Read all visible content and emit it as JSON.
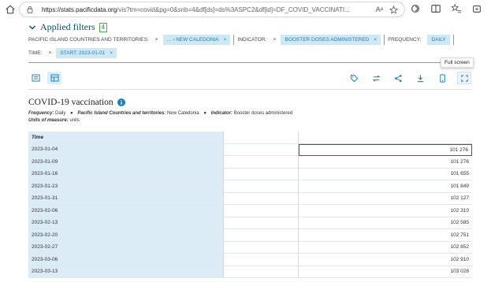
{
  "browser": {
    "url_host": "https://stats.pacificdata.org",
    "url_rest": "/vis?tm=covid&pg=0&snb=4&df[ds]=ds%3ASPC2&df[id]=DF_COVID_VACCINATI...",
    "reader_label": "Aᵃ"
  },
  "filters": {
    "title": "Applied filters",
    "count": "4",
    "row1": {
      "pict_label": "PACIFIC ISLAND COUNTRIES AND TERRITORIES:",
      "pict_chip": "... › NEW CALEDONIA",
      "indicator_label": "INDICATOR:",
      "indicator_chip": "BOOSTER DOSES ADMINISTERED",
      "frequency_label": "FREQUENCY:",
      "frequency_chip": "DAILY"
    },
    "row2": {
      "time_label": "TIME:",
      "time_chip": "START: 2023-01-01"
    },
    "remove_glyph": "×"
  },
  "tooltip": "Full screen",
  "header": {
    "title": "COVID-19 vaccination",
    "freq_key": "Frequency:",
    "freq_val": "Daily",
    "pict_key": "Pacific Island Countries and territories:",
    "pict_val": "New Caledonia",
    "ind_key": "Indicator:",
    "ind_val": "Booster doses administered",
    "units_key": "Units of measure:",
    "units_val": "units",
    "bullet": "●"
  },
  "table": {
    "header": "Time",
    "rows": [
      {
        "time": "2023-01-04",
        "value": "101 276"
      },
      {
        "time": "2023-01-09",
        "value": "101 276"
      },
      {
        "time": "2023-01-16",
        "value": "101 655"
      },
      {
        "time": "2023-01-23",
        "value": "101 849"
      },
      {
        "time": "2023-01-31",
        "value": "102 127"
      },
      {
        "time": "2023-02-06",
        "value": "102 310"
      },
      {
        "time": "2023-02-13",
        "value": "102 585"
      },
      {
        "time": "2023-02-20",
        "value": "102 751"
      },
      {
        "time": "2023-02-27",
        "value": "102 852"
      },
      {
        "time": "2023-03-06",
        "value": "102 910"
      },
      {
        "time": "2023-03-13",
        "value": "103 028"
      }
    ]
  },
  "colors": {
    "accent": "#1d7fb8",
    "chip_bg": "#cfe8f6",
    "time_col_bg": "#dcecf7",
    "count_badge": "#4caf50"
  }
}
